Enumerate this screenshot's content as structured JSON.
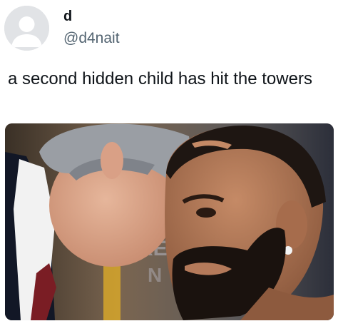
{
  "tweet": {
    "display_name": "d",
    "handle": "@d4nait",
    "text": "a second hidden child has hit the towers",
    "avatar_icon": "default-profile-icon",
    "media_description_icon": "photo"
  },
  "colors": {
    "name_text": "#0f1419",
    "handle_text": "#536471",
    "avatar_bg": "#e1e3e6",
    "avatar_figure": "#ffffff"
  }
}
